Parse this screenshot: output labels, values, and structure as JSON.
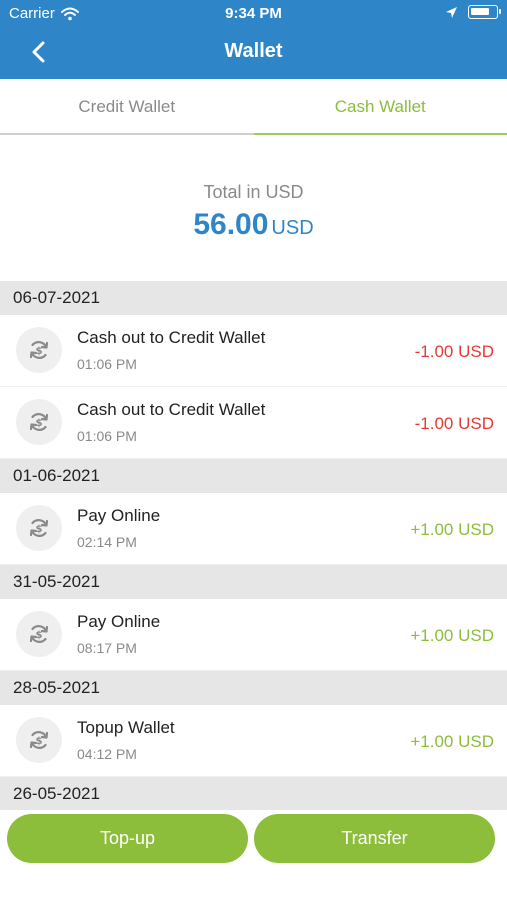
{
  "status_bar": {
    "carrier": "Carrier",
    "time": "9:34 PM"
  },
  "header": {
    "title": "Wallet"
  },
  "tabs": [
    {
      "label": "Credit Wallet",
      "active": false
    },
    {
      "label": "Cash Wallet",
      "active": true
    }
  ],
  "summary": {
    "label": "Total in USD",
    "amount": "56.00",
    "currency": "USD"
  },
  "groups": [
    {
      "date": "06-07-2021",
      "items": [
        {
          "title": "Cash out to Credit Wallet",
          "time": "01:06 PM",
          "amount": "-1.00 USD",
          "type": "debit"
        },
        {
          "title": "Cash out to Credit Wallet",
          "time": "01:06 PM",
          "amount": "-1.00 USD",
          "type": "debit"
        }
      ]
    },
    {
      "date": "01-06-2021",
      "items": [
        {
          "title": "Pay Online",
          "time": "02:14 PM",
          "amount": "+1.00 USD",
          "type": "credit"
        }
      ]
    },
    {
      "date": "31-05-2021",
      "items": [
        {
          "title": "Pay Online",
          "time": "08:17 PM",
          "amount": "+1.00 USD",
          "type": "credit"
        }
      ]
    },
    {
      "date": "28-05-2021",
      "items": [
        {
          "title": "Topup Wallet",
          "time": "04:12 PM",
          "amount": "+1.00 USD",
          "type": "credit"
        }
      ]
    },
    {
      "date": "26-05-2021",
      "items": []
    }
  ],
  "actions": {
    "topup": "Top-up",
    "transfer": "Transfer"
  },
  "colors": {
    "primary": "#2e86c9",
    "accent": "#8cbd3b",
    "negative": "#e53935"
  },
  "icons": {
    "transaction": "exchange-icon"
  }
}
